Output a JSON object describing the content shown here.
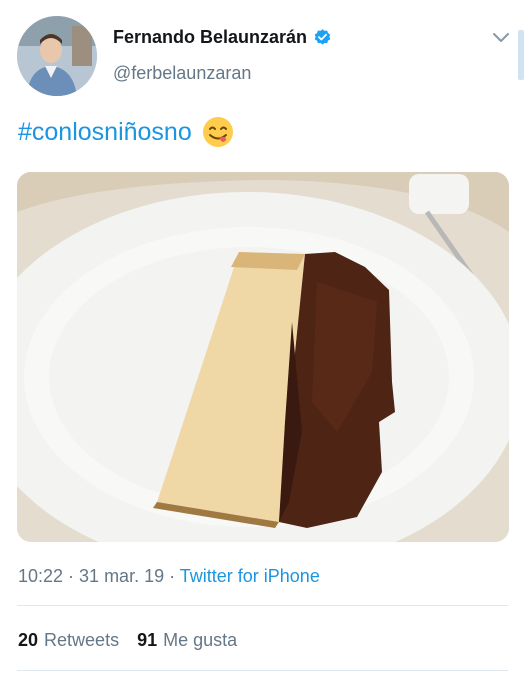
{
  "tweet": {
    "author_name": "Fernando Belaunzarán",
    "handle": "@ferbelaunzaran",
    "text": "#conlosniñosno",
    "emoji": "face-savoring-food-emoji",
    "timestamp": "10:22 · 31 mar. 19 · ",
    "source": "Twitter for iPhone",
    "retweets_count": "20",
    "retweets_label": "Retweets",
    "likes_count": "91",
    "likes_label": "Me gusta"
  },
  "colors": {
    "link": "#1b95e0",
    "secondary_text": "#657786",
    "primary_text": "#14171a",
    "verified_badge": "#1da1f2"
  },
  "icons": [
    "verified-badge-icon",
    "chevron-down-icon"
  ]
}
